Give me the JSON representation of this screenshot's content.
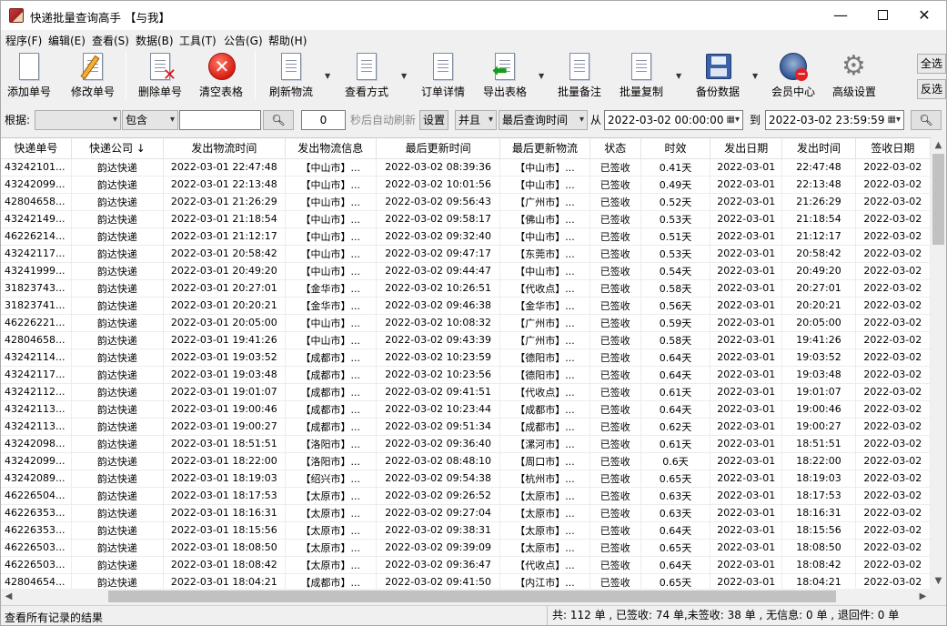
{
  "window": {
    "title": "快递批量查询高手 【与我】",
    "minimize_glyph": "—",
    "close_glyph": "✕"
  },
  "menu": [
    "程序(F)",
    "编辑(E)",
    "查看(S)",
    "数据(B)",
    "工具(T)",
    "公告(G)",
    "帮助(H)"
  ],
  "toolbar": {
    "buttons": [
      {
        "label": "添加单号",
        "icon": "add-doc-icon"
      },
      {
        "label": "修改单号",
        "icon": "edit-doc-icon"
      },
      {
        "label": "删除单号",
        "icon": "delete-doc-icon"
      },
      {
        "label": "清空表格",
        "icon": "clear-table-icon"
      },
      {
        "label": "刷新物流",
        "icon": "refresh-icon"
      },
      {
        "label": "查看方式",
        "icon": "view-mode-icon"
      },
      {
        "label": "订单详情",
        "icon": "order-detail-icon"
      },
      {
        "label": "导出表格",
        "icon": "export-icon"
      },
      {
        "label": "批量备注",
        "icon": "batch-note-icon"
      },
      {
        "label": "批量复制",
        "icon": "batch-copy-icon"
      },
      {
        "label": "备份数据",
        "icon": "backup-icon"
      },
      {
        "label": "会员中心",
        "icon": "member-center-icon"
      },
      {
        "label": "高级设置",
        "icon": "settings-icon"
      }
    ],
    "select_all": "全选",
    "invert_select": "反选"
  },
  "filter": {
    "basis_label": "根据:",
    "basis_value": "",
    "match_value": "包含",
    "keyword_value": "",
    "refresh_seconds": "0",
    "auto_refresh_label": "秒后自动刷新",
    "set_button": "设置",
    "logic_value": "并且",
    "time_field_value": "最后查询时间",
    "from_label": "从",
    "from_value": "2022-03-02 00:00:00",
    "to_label": "到",
    "to_value": "2022-03-02 23:59:59"
  },
  "table": {
    "columns": [
      "快递单号",
      "快递公司 ↓",
      "发出物流时间",
      "发出物流信息",
      "最后更新时间",
      "最后更新物流",
      "状态",
      "时效",
      "发出日期",
      "发出时间",
      "签收日期"
    ],
    "rows": [
      [
        "43242101...",
        "韵达快递",
        "2022-03-01 22:47:48",
        "【中山市】...",
        "2022-03-02 08:39:36",
        "【中山市】...",
        "已签收",
        "0.41天",
        "2022-03-01",
        "22:47:48",
        "2022-03-02"
      ],
      [
        "43242099...",
        "韵达快递",
        "2022-03-01 22:13:48",
        "【中山市】...",
        "2022-03-02 10:01:56",
        "【中山市】...",
        "已签收",
        "0.49天",
        "2022-03-01",
        "22:13:48",
        "2022-03-02"
      ],
      [
        "42804658...",
        "韵达快递",
        "2022-03-01 21:26:29",
        "【中山市】...",
        "2022-03-02 09:56:43",
        "【广州市】...",
        "已签收",
        "0.52天",
        "2022-03-01",
        "21:26:29",
        "2022-03-02"
      ],
      [
        "43242149...",
        "韵达快递",
        "2022-03-01 21:18:54",
        "【中山市】...",
        "2022-03-02 09:58:17",
        "【佛山市】...",
        "已签收",
        "0.53天",
        "2022-03-01",
        "21:18:54",
        "2022-03-02"
      ],
      [
        "46226214...",
        "韵达快递",
        "2022-03-01 21:12:17",
        "【中山市】...",
        "2022-03-02 09:32:40",
        "【中山市】...",
        "已签收",
        "0.51天",
        "2022-03-01",
        "21:12:17",
        "2022-03-02"
      ],
      [
        "43242117...",
        "韵达快递",
        "2022-03-01 20:58:42",
        "【中山市】...",
        "2022-03-02 09:47:17",
        "【东莞市】...",
        "已签收",
        "0.53天",
        "2022-03-01",
        "20:58:42",
        "2022-03-02"
      ],
      [
        "43241999...",
        "韵达快递",
        "2022-03-01 20:49:20",
        "【中山市】...",
        "2022-03-02 09:44:47",
        "【中山市】...",
        "已签收",
        "0.54天",
        "2022-03-01",
        "20:49:20",
        "2022-03-02"
      ],
      [
        "31823743...",
        "韵达快递",
        "2022-03-01 20:27:01",
        "【金华市】...",
        "2022-03-02 10:26:51",
        "【代收点】...",
        "已签收",
        "0.58天",
        "2022-03-01",
        "20:27:01",
        "2022-03-02"
      ],
      [
        "31823741...",
        "韵达快递",
        "2022-03-01 20:20:21",
        "【金华市】...",
        "2022-03-02 09:46:38",
        "【金华市】...",
        "已签收",
        "0.56天",
        "2022-03-01",
        "20:20:21",
        "2022-03-02"
      ],
      [
        "46226221...",
        "韵达快递",
        "2022-03-01 20:05:00",
        "【中山市】...",
        "2022-03-02 10:08:32",
        "【广州市】...",
        "已签收",
        "0.59天",
        "2022-03-01",
        "20:05:00",
        "2022-03-02"
      ],
      [
        "42804658...",
        "韵达快递",
        "2022-03-01 19:41:26",
        "【中山市】...",
        "2022-03-02 09:43:39",
        "【广州市】...",
        "已签收",
        "0.58天",
        "2022-03-01",
        "19:41:26",
        "2022-03-02"
      ],
      [
        "43242114...",
        "韵达快递",
        "2022-03-01 19:03:52",
        "【成都市】...",
        "2022-03-02 10:23:59",
        "【德阳市】...",
        "已签收",
        "0.64天",
        "2022-03-01",
        "19:03:52",
        "2022-03-02"
      ],
      [
        "43242117...",
        "韵达快递",
        "2022-03-01 19:03:48",
        "【成都市】...",
        "2022-03-02 10:23:56",
        "【德阳市】...",
        "已签收",
        "0.64天",
        "2022-03-01",
        "19:03:48",
        "2022-03-02"
      ],
      [
        "43242112...",
        "韵达快递",
        "2022-03-01 19:01:07",
        "【成都市】...",
        "2022-03-02 09:41:51",
        "【代收点】...",
        "已签收",
        "0.61天",
        "2022-03-01",
        "19:01:07",
        "2022-03-02"
      ],
      [
        "43242113...",
        "韵达快递",
        "2022-03-01 19:00:46",
        "【成都市】...",
        "2022-03-02 10:23:44",
        "【成都市】...",
        "已签收",
        "0.64天",
        "2022-03-01",
        "19:00:46",
        "2022-03-02"
      ],
      [
        "43242113...",
        "韵达快递",
        "2022-03-01 19:00:27",
        "【成都市】...",
        "2022-03-02 09:51:34",
        "【成都市】...",
        "已签收",
        "0.62天",
        "2022-03-01",
        "19:00:27",
        "2022-03-02"
      ],
      [
        "43242098...",
        "韵达快递",
        "2022-03-01 18:51:51",
        "【洛阳市】...",
        "2022-03-02 09:36:40",
        "【漯河市】...",
        "已签收",
        "0.61天",
        "2022-03-01",
        "18:51:51",
        "2022-03-02"
      ],
      [
        "43242099...",
        "韵达快递",
        "2022-03-01 18:22:00",
        "【洛阳市】...",
        "2022-03-02 08:48:10",
        "【周口市】...",
        "已签收",
        "0.6天",
        "2022-03-01",
        "18:22:00",
        "2022-03-02"
      ],
      [
        "43242089...",
        "韵达快递",
        "2022-03-01 18:19:03",
        "【绍兴市】...",
        "2022-03-02 09:54:38",
        "【杭州市】...",
        "已签收",
        "0.65天",
        "2022-03-01",
        "18:19:03",
        "2022-03-02"
      ],
      [
        "46226504...",
        "韵达快递",
        "2022-03-01 18:17:53",
        "【太原市】...",
        "2022-03-02 09:26:52",
        "【太原市】...",
        "已签收",
        "0.63天",
        "2022-03-01",
        "18:17:53",
        "2022-03-02"
      ],
      [
        "46226353...",
        "韵达快递",
        "2022-03-01 18:16:31",
        "【太原市】...",
        "2022-03-02 09:27:04",
        "【太原市】...",
        "已签收",
        "0.63天",
        "2022-03-01",
        "18:16:31",
        "2022-03-02"
      ],
      [
        "46226353...",
        "韵达快递",
        "2022-03-01 18:15:56",
        "【太原市】...",
        "2022-03-02 09:38:31",
        "【太原市】...",
        "已签收",
        "0.64天",
        "2022-03-01",
        "18:15:56",
        "2022-03-02"
      ],
      [
        "46226503...",
        "韵达快递",
        "2022-03-01 18:08:50",
        "【太原市】...",
        "2022-03-02 09:39:09",
        "【太原市】...",
        "已签收",
        "0.65天",
        "2022-03-01",
        "18:08:50",
        "2022-03-02"
      ],
      [
        "46226503...",
        "韵达快递",
        "2022-03-01 18:08:42",
        "【太原市】...",
        "2022-03-02 09:36:47",
        "【代收点】...",
        "已签收",
        "0.64天",
        "2022-03-01",
        "18:08:42",
        "2022-03-02"
      ],
      [
        "42804654...",
        "韵达快递",
        "2022-03-01 18:04:21",
        "【成都市】...",
        "2022-03-02 09:41:50",
        "【内江市】...",
        "已签收",
        "0.65天",
        "2022-03-01",
        "18:04:21",
        "2022-03-02"
      ]
    ]
  },
  "status": {
    "left": "查看所有记录的结果",
    "right": "共: 112 单 , 已签收:  74 单,未签收:  38 单 , 无信息: 0 单 , 退回件: 0 单"
  }
}
